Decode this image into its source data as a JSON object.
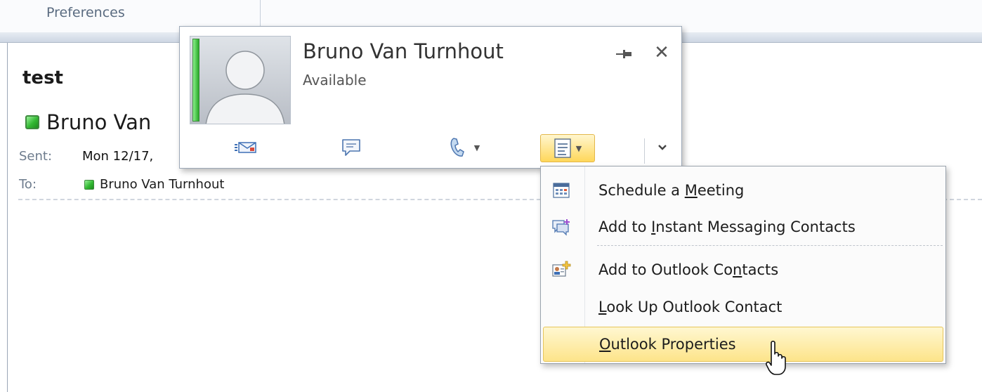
{
  "ribbon": {
    "group_label": "Preferences"
  },
  "message": {
    "subject": "test",
    "sender_display": "Bruno Van",
    "sent_label": "Sent:",
    "sent_value": "Mon 12/17,",
    "to_label": "To:",
    "to_value": "Bruno Van Turnhout"
  },
  "contact_card": {
    "name": "Bruno Van Turnhout",
    "status": "Available",
    "presence_color": "#2fb52f",
    "actions": [
      "email-icon",
      "im-icon",
      "phone-icon",
      "schedule-meeting-icon",
      "expand-icon"
    ]
  },
  "context_menu": {
    "items": [
      {
        "label": "Schedule a Meeting",
        "access_key": "M",
        "icon": "calendar-icon"
      },
      {
        "label": "Add to Instant Messaging Contacts",
        "access_key": "I",
        "icon": "im-add-icon"
      },
      {
        "label": "Add to Outlook Contacts",
        "access_key": "n",
        "icon": "contact-add-icon"
      },
      {
        "label": "Look Up Outlook Contact",
        "access_key": "L",
        "icon": ""
      },
      {
        "label": "Outlook Properties",
        "access_key": "O",
        "icon": "",
        "highlighted": true
      }
    ]
  }
}
